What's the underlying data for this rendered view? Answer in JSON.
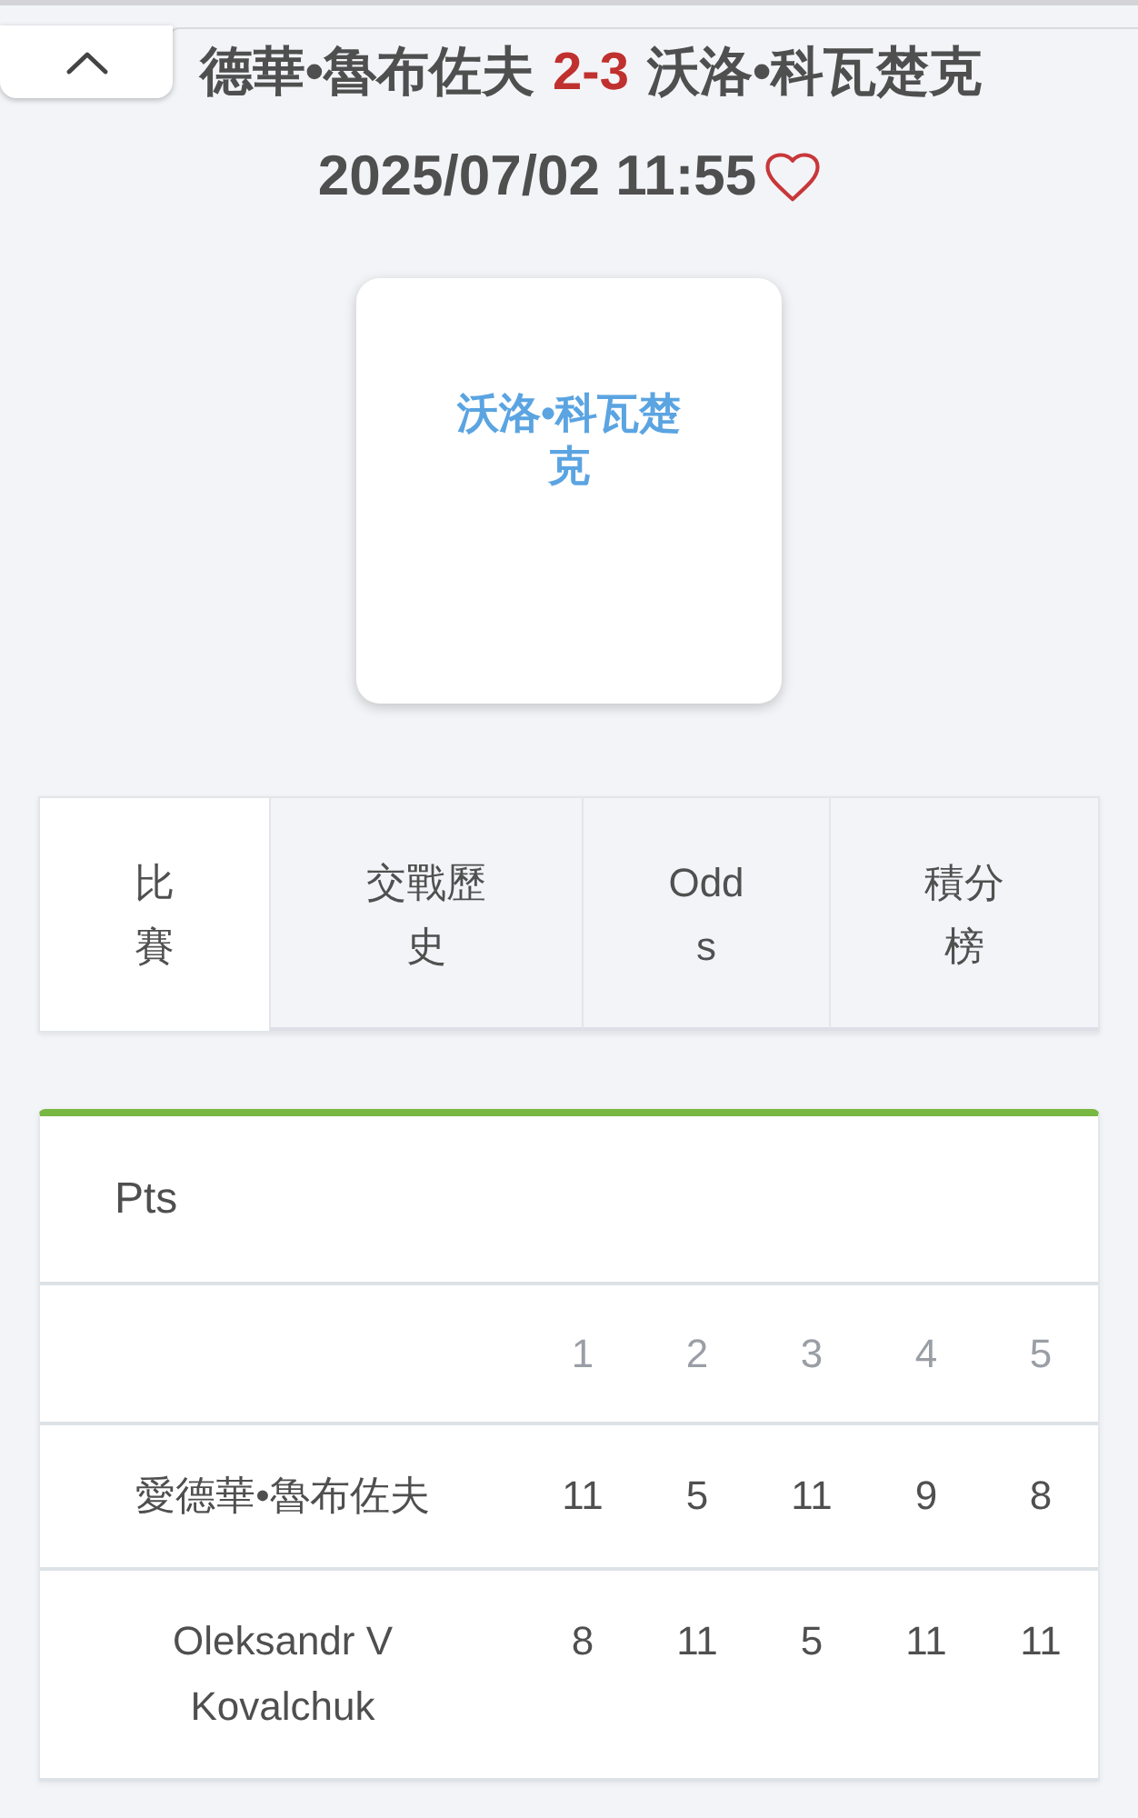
{
  "header": {
    "home": "德華•魯布佐夫",
    "score": "2-3",
    "away": "沃洛•科瓦楚克",
    "datetime": "2025/07/02 11:55",
    "favorite": false
  },
  "logo_card": {
    "name": "沃洛•科瓦楚克"
  },
  "tabs": [
    {
      "label": "比賽",
      "selected": true
    },
    {
      "label": "交戰歷史",
      "selected": false
    },
    {
      "label": "Odds",
      "selected": false
    },
    {
      "label": "積分榜",
      "selected": false
    }
  ],
  "scores": {
    "title": "Pts",
    "columns": [
      "1",
      "2",
      "3",
      "4",
      "5"
    ],
    "rows": [
      {
        "player": "愛德華•魯布佐夫",
        "points": [
          "11",
          "5",
          "11",
          "9",
          "8"
        ]
      },
      {
        "player": "Oleksandr V Kovalchuk",
        "points": [
          "8",
          "11",
          "5",
          "11",
          "11"
        ]
      }
    ]
  }
}
